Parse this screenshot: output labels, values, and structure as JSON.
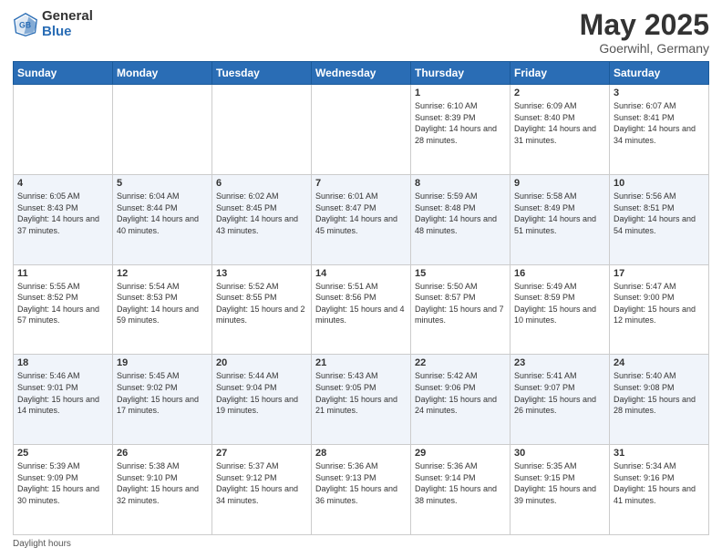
{
  "header": {
    "logo_general": "General",
    "logo_blue": "Blue",
    "title": "May 2025",
    "subtitle": "Goerwihl, Germany"
  },
  "weekdays": [
    "Sunday",
    "Monday",
    "Tuesday",
    "Wednesday",
    "Thursday",
    "Friday",
    "Saturday"
  ],
  "weeks": [
    [
      {
        "day": "",
        "info": ""
      },
      {
        "day": "",
        "info": ""
      },
      {
        "day": "",
        "info": ""
      },
      {
        "day": "",
        "info": ""
      },
      {
        "day": "1",
        "info": "Sunrise: 6:10 AM\nSunset: 8:39 PM\nDaylight: 14 hours\nand 28 minutes."
      },
      {
        "day": "2",
        "info": "Sunrise: 6:09 AM\nSunset: 8:40 PM\nDaylight: 14 hours\nand 31 minutes."
      },
      {
        "day": "3",
        "info": "Sunrise: 6:07 AM\nSunset: 8:41 PM\nDaylight: 14 hours\nand 34 minutes."
      }
    ],
    [
      {
        "day": "4",
        "info": "Sunrise: 6:05 AM\nSunset: 8:43 PM\nDaylight: 14 hours\nand 37 minutes."
      },
      {
        "day": "5",
        "info": "Sunrise: 6:04 AM\nSunset: 8:44 PM\nDaylight: 14 hours\nand 40 minutes."
      },
      {
        "day": "6",
        "info": "Sunrise: 6:02 AM\nSunset: 8:45 PM\nDaylight: 14 hours\nand 43 minutes."
      },
      {
        "day": "7",
        "info": "Sunrise: 6:01 AM\nSunset: 8:47 PM\nDaylight: 14 hours\nand 45 minutes."
      },
      {
        "day": "8",
        "info": "Sunrise: 5:59 AM\nSunset: 8:48 PM\nDaylight: 14 hours\nand 48 minutes."
      },
      {
        "day": "9",
        "info": "Sunrise: 5:58 AM\nSunset: 8:49 PM\nDaylight: 14 hours\nand 51 minutes."
      },
      {
        "day": "10",
        "info": "Sunrise: 5:56 AM\nSunset: 8:51 PM\nDaylight: 14 hours\nand 54 minutes."
      }
    ],
    [
      {
        "day": "11",
        "info": "Sunrise: 5:55 AM\nSunset: 8:52 PM\nDaylight: 14 hours\nand 57 minutes."
      },
      {
        "day": "12",
        "info": "Sunrise: 5:54 AM\nSunset: 8:53 PM\nDaylight: 14 hours\nand 59 minutes."
      },
      {
        "day": "13",
        "info": "Sunrise: 5:52 AM\nSunset: 8:55 PM\nDaylight: 15 hours\nand 2 minutes."
      },
      {
        "day": "14",
        "info": "Sunrise: 5:51 AM\nSunset: 8:56 PM\nDaylight: 15 hours\nand 4 minutes."
      },
      {
        "day": "15",
        "info": "Sunrise: 5:50 AM\nSunset: 8:57 PM\nDaylight: 15 hours\nand 7 minutes."
      },
      {
        "day": "16",
        "info": "Sunrise: 5:49 AM\nSunset: 8:59 PM\nDaylight: 15 hours\nand 10 minutes."
      },
      {
        "day": "17",
        "info": "Sunrise: 5:47 AM\nSunset: 9:00 PM\nDaylight: 15 hours\nand 12 minutes."
      }
    ],
    [
      {
        "day": "18",
        "info": "Sunrise: 5:46 AM\nSunset: 9:01 PM\nDaylight: 15 hours\nand 14 minutes."
      },
      {
        "day": "19",
        "info": "Sunrise: 5:45 AM\nSunset: 9:02 PM\nDaylight: 15 hours\nand 17 minutes."
      },
      {
        "day": "20",
        "info": "Sunrise: 5:44 AM\nSunset: 9:04 PM\nDaylight: 15 hours\nand 19 minutes."
      },
      {
        "day": "21",
        "info": "Sunrise: 5:43 AM\nSunset: 9:05 PM\nDaylight: 15 hours\nand 21 minutes."
      },
      {
        "day": "22",
        "info": "Sunrise: 5:42 AM\nSunset: 9:06 PM\nDaylight: 15 hours\nand 24 minutes."
      },
      {
        "day": "23",
        "info": "Sunrise: 5:41 AM\nSunset: 9:07 PM\nDaylight: 15 hours\nand 26 minutes."
      },
      {
        "day": "24",
        "info": "Sunrise: 5:40 AM\nSunset: 9:08 PM\nDaylight: 15 hours\nand 28 minutes."
      }
    ],
    [
      {
        "day": "25",
        "info": "Sunrise: 5:39 AM\nSunset: 9:09 PM\nDaylight: 15 hours\nand 30 minutes."
      },
      {
        "day": "26",
        "info": "Sunrise: 5:38 AM\nSunset: 9:10 PM\nDaylight: 15 hours\nand 32 minutes."
      },
      {
        "day": "27",
        "info": "Sunrise: 5:37 AM\nSunset: 9:12 PM\nDaylight: 15 hours\nand 34 minutes."
      },
      {
        "day": "28",
        "info": "Sunrise: 5:36 AM\nSunset: 9:13 PM\nDaylight: 15 hours\nand 36 minutes."
      },
      {
        "day": "29",
        "info": "Sunrise: 5:36 AM\nSunset: 9:14 PM\nDaylight: 15 hours\nand 38 minutes."
      },
      {
        "day": "30",
        "info": "Sunrise: 5:35 AM\nSunset: 9:15 PM\nDaylight: 15 hours\nand 39 minutes."
      },
      {
        "day": "31",
        "info": "Sunrise: 5:34 AM\nSunset: 9:16 PM\nDaylight: 15 hours\nand 41 minutes."
      }
    ]
  ],
  "footer": {
    "daylight_label": "Daylight hours"
  }
}
